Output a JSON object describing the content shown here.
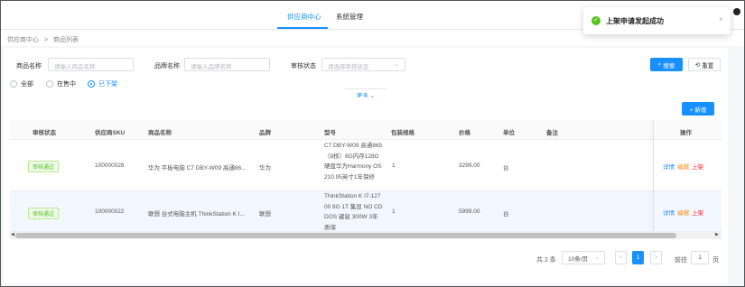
{
  "topnav": {
    "items": [
      {
        "label": "供应商中心"
      },
      {
        "label": "系统管理"
      }
    ]
  },
  "breadcrumb": {
    "items": [
      "供应商中心",
      ">",
      "商品列表"
    ]
  },
  "filters": {
    "product_name_label": "商品名称",
    "product_name_placeholder": "请输入商品名称",
    "brand_label": "品牌名称",
    "brand_placeholder": "请输入品牌名称",
    "status_label": "审核状态",
    "status_placeholder": "请选择审核状态",
    "search_button": "搜索",
    "reset_button": "重置",
    "more_label": "更多 ⌄",
    "radios": [
      {
        "label": "全部"
      },
      {
        "label": "在售中"
      },
      {
        "label": "已下架"
      }
    ],
    "selected_radio": "已下架"
  },
  "table": {
    "add_button": "+ 新增",
    "columns": [
      "审核状态",
      "供应商SKU",
      "商品名称",
      "品牌",
      "型号",
      "包装规格",
      "价格",
      "单位",
      "备注",
      "操作"
    ],
    "rows": [
      {
        "status": "审核通过",
        "sku": "100000028",
        "name": "华为 平板电脑 C7 DBY-W09 高通86...",
        "brand": "华为",
        "model": "C7 DBY-W09 高通865（8核）6G内存128G硬盘华为Harmony OS210.95英寸1年保修",
        "pack": "1",
        "price": "3299.00",
        "unit": "台",
        "note": ""
      },
      {
        "status": "审核通过",
        "sku": "100000022",
        "name": "联想 台式电脑主机 ThinkStation K I...",
        "brand": "联想",
        "model": "ThinkStation K I7-12700 8G 1T 集显 NO CD DOS 键鼠 300W 3年质保",
        "pack": "1",
        "price": "5999.00",
        "unit": "台",
        "note": ""
      }
    ],
    "ops": {
      "detail": "详情",
      "edit": "编辑",
      "shelf": "上架"
    }
  },
  "pagination": {
    "total": "共 2 条",
    "page_size": "10条/页",
    "prev": "<",
    "current": "1",
    "next": ">",
    "goto_label": "前往",
    "goto_value": "1",
    "page_unit": "页"
  },
  "toast": {
    "message": "上架申请发起成功",
    "close": "×"
  },
  "colors": {
    "primary": "#1890ff",
    "success": "#52c41a",
    "warning": "#fa8c16",
    "danger": "#f5222d"
  }
}
